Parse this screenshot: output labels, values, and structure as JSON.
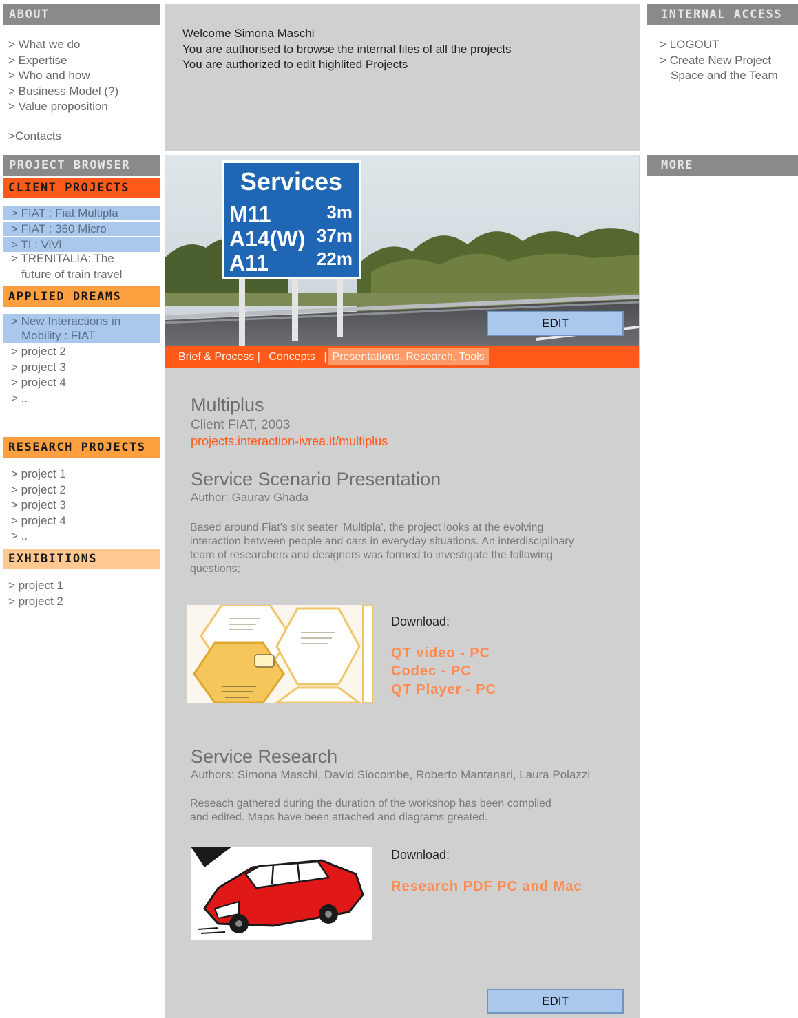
{
  "left": {
    "about": {
      "header": "ABOUT",
      "items": [
        "> What we do",
        "> Expertise",
        "> Who and how",
        "> Business Model (?)",
        "> Value proposition"
      ],
      "contacts": ">Contacts"
    },
    "browser_header": "PROJECT BROWSER",
    "client": {
      "header": "CLIENT PROJECTS",
      "hl1": "> FIAT : Fiat Multipla",
      "hl2": "> FIAT : 360 Micro",
      "hl3": "> TI : ViVi",
      "item1": "> TRENITALIA: The",
      "item1b": "future of train travel"
    },
    "applied": {
      "header": "APPLIED DREAMS",
      "hl1": "> New Interactions in",
      "hl1b": "Mobility : FIAT",
      "items": [
        "> project 2",
        "> project 3",
        "> project 4",
        "> .."
      ]
    },
    "research": {
      "header": "RESEARCH PROJECTS",
      "items": [
        "> project 1",
        "> project 2",
        "> project 3",
        "> project 4",
        "> .."
      ]
    },
    "exhibitions": {
      "header": "EXHIBITIONS",
      "items": [
        "> project 1",
        "> project 2"
      ]
    }
  },
  "welcome": {
    "line1": "Welcome Simona Maschi",
    "line2": "You are authorised to browse the internal files of all the projects",
    "line3": "You are authorized to edit highlited Projects"
  },
  "right": {
    "internal_header": "INTERNAL ACCESS",
    "logout": "> LOGOUT",
    "create1": "> Create New Project",
    "create2": "Space and the Team",
    "more_header": "MORE"
  },
  "hero": {
    "sign_title": "Services",
    "rows": [
      {
        "road": "M11",
        "dist": "3m"
      },
      {
        "road": "A14(W)",
        "dist": "37m"
      },
      {
        "road": "A11",
        "dist": "22m"
      }
    ]
  },
  "edit_label": "EDIT",
  "tabs": {
    "t1": "Brief & Process |",
    "t2": "Concepts",
    "sep": "|",
    "t3": "Presentations, Research, Tools"
  },
  "project": {
    "title": "Multiplus",
    "client": "Client FIAT, 2003",
    "url": "projects.interaction-ivrea.it/multiplus"
  },
  "sec1": {
    "title": "Service Scenario Presentation",
    "author": "Author: Gaurav Ghada",
    "p1": "Based around Fiat's six seater 'Multipla', the project looks at the evolving",
    "p2": "interaction between people and cars in everyday situations. An interdisciplinary",
    "p3": "team of researchers and designers was formed to investigate the following",
    "p4": "questions;",
    "download": "Download:",
    "l1": "QT video - PC",
    "l2": "Codec - PC",
    "l3": "QT Player - PC"
  },
  "sec2": {
    "title": "Service Research",
    "authors": "Authors: Simona Maschi, David Slocombe, Roberto Mantanari, Laura Polazzi",
    "p1": "Reseach gathered during the duration of the workshop has been compiled",
    "p2": "and edited. Maps have been attached and diagrams greated.",
    "download": "Download:",
    "l1": "Research PDF PC and Mac"
  },
  "colors": {
    "accent": "#ff5a1a",
    "orange": "#ffa040",
    "highlight": "#a9c8ec",
    "panel": "#d0d0d0",
    "header_bg": "#8a8a8a"
  }
}
